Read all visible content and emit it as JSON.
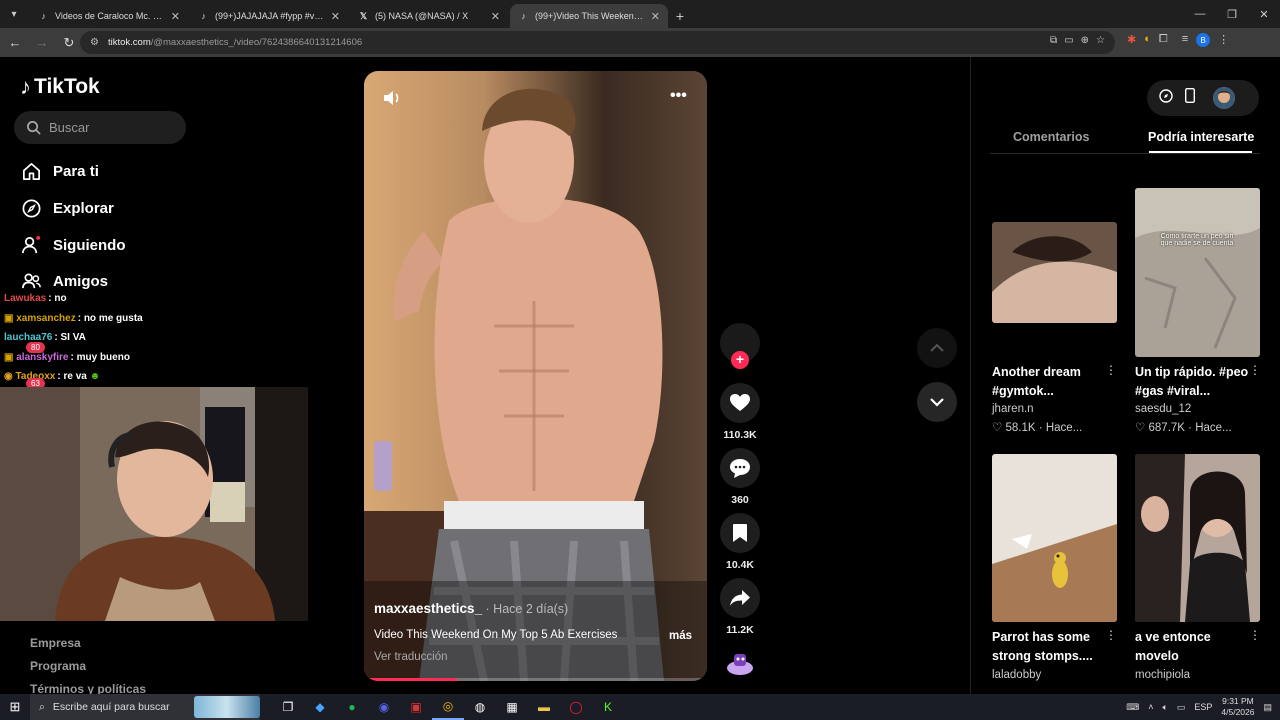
{
  "browser": {
    "tabs": [
      {
        "title": "Videos de Caraloco Mc. (@cara",
        "icon": "tiktok-icon",
        "active": false
      },
      {
        "title": "(99+)JAJAJAJA #fypp #viral #p",
        "icon": "tiktok-icon",
        "active": false
      },
      {
        "title": "(5) NASA (@NASA) / X",
        "icon": "x-icon",
        "active": false
      },
      {
        "title": "(99+)Video This Weekend On M",
        "icon": "tiktok-icon",
        "active": true
      }
    ],
    "url_host": "tiktok.com",
    "url_path": "/@maxxaesthetics_/video/7624386640131214606",
    "profile_letter": "B"
  },
  "sidebar": {
    "logo": "TikTok",
    "search_placeholder": "Buscar",
    "items": [
      {
        "label": "Para ti",
        "icon": "home-icon"
      },
      {
        "label": "Explorar",
        "icon": "compass-icon"
      },
      {
        "label": "Siguiendo",
        "icon": "following-icon"
      },
      {
        "label": "Amigos",
        "icon": "friends-icon"
      }
    ],
    "footer_links": [
      "Empresa",
      "Programa",
      "Términos y políticas"
    ]
  },
  "chat": {
    "messages": [
      {
        "user": "Lawukas",
        "text": ": no",
        "color": "#e24b4b"
      },
      {
        "user": "xamsanchez",
        "text": ": no me gusta",
        "color": "#d6a300"
      },
      {
        "user": "lauchaa76",
        "text": ": SI VA",
        "color": "#4fc7d0"
      },
      {
        "user": "alanskyfire",
        "text": ": muy bueno",
        "color": "#c96ad8"
      },
      {
        "user": "Tadeoxx",
        "text": ": re va",
        "color": "#e0a21c"
      }
    ],
    "badges": [
      "80",
      "63"
    ]
  },
  "video": {
    "author": "maxxaesthetics_",
    "time": " · Hace 2 día(s)",
    "caption": "Video This Weekend On My Top 5 Ab Exercises",
    "more": "más",
    "translate": "Ver traducción",
    "progress": 0.27
  },
  "actions": {
    "likes": "110.3K",
    "comments": "360",
    "saves": "10.4K",
    "shares": "11.2K"
  },
  "right_panel": {
    "tabs": [
      "Comentarios",
      "Podría interesarte"
    ],
    "cards": [
      {
        "title": "Another dream #gymtok...",
        "user": "jharen.n",
        "likes": "58.1K",
        "time": "Hace..."
      },
      {
        "title": "Un tip rápido. #peo #gas #viral...",
        "user": "saesdu_12",
        "likes": "687.7K",
        "time": "Hace...",
        "overlay": "Como tirarte un peo sin que nadie se de cuenta"
      },
      {
        "title": "Parrot has some strong stomps....",
        "user": "laladobby"
      },
      {
        "title": "a ve entonce movelo",
        "user": "mochipiola"
      }
    ]
  },
  "taskbar": {
    "search_placeholder": "Escribe aquí para buscar",
    "lang": "ESP",
    "time": "9:31 PM",
    "date": "4/5/2026"
  }
}
